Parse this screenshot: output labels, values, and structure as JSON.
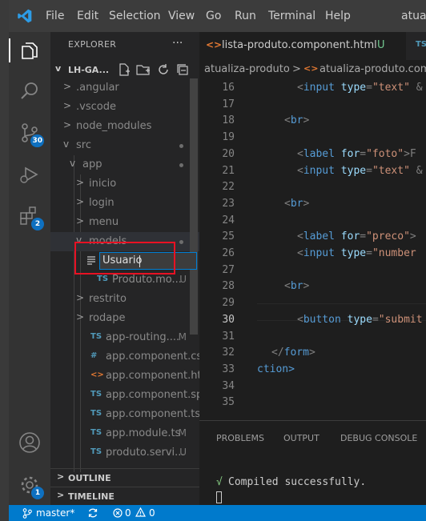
{
  "colors": {
    "accent": "#007acc",
    "badge": "#0e70c0",
    "annotation": "#e81123",
    "keyword": "#569cd6",
    "tag": "#569cd6",
    "attr": "#9cdcfe",
    "string": "#ce9178",
    "success": "#89d185"
  },
  "titlebar": {
    "menu": [
      "File",
      "Edit",
      "Selection",
      "View",
      "Go",
      "Run",
      "Terminal",
      "Help"
    ],
    "title": "atuali"
  },
  "activity": {
    "items": [
      {
        "name": "explorer-icon"
      },
      {
        "name": "search-icon"
      },
      {
        "name": "source-control-icon",
        "badge": "30"
      },
      {
        "name": "run-debug-icon"
      },
      {
        "name": "extensions-icon",
        "badge": "2"
      }
    ],
    "account_icon": "account-icon",
    "manage_icon": "gear-icon",
    "manage_badge": "1"
  },
  "explorer": {
    "header": "EXPLORER",
    "more": "···",
    "project": "LH-GA...",
    "toolbar_icons": [
      "new-file-icon",
      "new-folder-icon",
      "refresh-icon",
      "collapse-all-icon"
    ],
    "tree": [
      {
        "label": ".angular",
        "depth": 1,
        "chev": ">"
      },
      {
        "label": ".vscode",
        "depth": 1,
        "chev": ">"
      },
      {
        "label": "node_modules",
        "depth": 1,
        "chev": ">"
      },
      {
        "label": "src",
        "depth": 1,
        "chev": "v",
        "dot": true
      },
      {
        "label": "app",
        "depth": 2,
        "chev": "v",
        "dot": true
      },
      {
        "label": "inicio",
        "depth": 3,
        "chev": ">"
      },
      {
        "label": "login",
        "depth": 3,
        "chev": ">"
      },
      {
        "label": "menu",
        "depth": 3,
        "chev": ">"
      },
      {
        "label": "models",
        "depth": 3,
        "chev": "v",
        "dot": true
      },
      {
        "label": "",
        "depth": 4,
        "rename": true
      },
      {
        "label": "Produto.mo...",
        "depth": 4,
        "icon": "TS",
        "dec": "U"
      },
      {
        "label": "restrito",
        "depth": 3,
        "chev": ">"
      },
      {
        "label": "rodape",
        "depth": 3,
        "chev": ">"
      },
      {
        "label": "app-routing....",
        "depth": 3,
        "icon": "TS",
        "dec": "M"
      },
      {
        "label": "app.component.css",
        "depth": 3,
        "icon": "#"
      },
      {
        "label": "app.component.html",
        "depth": 3,
        "icon": "<>"
      },
      {
        "label": "app.component.sp...",
        "depth": 3,
        "icon": "TS"
      },
      {
        "label": "app.component.ts",
        "depth": 3,
        "icon": "TS"
      },
      {
        "label": "app.module.ts",
        "depth": 3,
        "icon": "TS",
        "dec": "M"
      },
      {
        "label": "produto.servi...",
        "depth": 3,
        "icon": "TS",
        "dec": "U"
      }
    ],
    "rename_value": "Usuario",
    "outline": "OUTLINE",
    "timeline": "TIMELINE"
  },
  "tabs": {
    "active": "lista-produto.component.html",
    "active_dec": "U",
    "next": "TS"
  },
  "breadcrumb": {
    "folder": "atualiza-produto",
    "sep": ">",
    "file": "atualiza-produto.com"
  },
  "editor": {
    "lines": [
      {
        "n": "16",
        "indent": 3,
        "tokens": [
          [
            "<",
            "p"
          ],
          [
            "input",
            "tag"
          ],
          [
            " ",
            "p"
          ],
          [
            "type",
            "attr"
          ],
          [
            "=",
            "p"
          ],
          [
            "\"text\"",
            "str"
          ],
          [
            " ",
            "p"
          ],
          [
            "&",
            "p"
          ]
        ]
      },
      {
        "n": "17",
        "indent": 0,
        "tokens": []
      },
      {
        "n": "18",
        "indent": 2,
        "tokens": [
          [
            "<",
            "p"
          ],
          [
            "br",
            "tag"
          ],
          [
            ">",
            "p"
          ]
        ]
      },
      {
        "n": "19",
        "indent": 0,
        "tokens": []
      },
      {
        "n": "20",
        "indent": 3,
        "tokens": [
          [
            "<",
            "p"
          ],
          [
            "label",
            "tag"
          ],
          [
            " ",
            "p"
          ],
          [
            "for",
            "attr"
          ],
          [
            "=",
            "p"
          ],
          [
            "\"foto\"",
            "str"
          ],
          [
            ">F",
            "p"
          ]
        ]
      },
      {
        "n": "21",
        "indent": 3,
        "tokens": [
          [
            "<",
            "p"
          ],
          [
            "input",
            "tag"
          ],
          [
            " ",
            "p"
          ],
          [
            "type",
            "attr"
          ],
          [
            "=",
            "p"
          ],
          [
            "\"text\"",
            "str"
          ],
          [
            " ",
            "p"
          ],
          [
            "&",
            "p"
          ]
        ]
      },
      {
        "n": "22",
        "indent": 0,
        "tokens": []
      },
      {
        "n": "23",
        "indent": 2,
        "tokens": [
          [
            "<",
            "p"
          ],
          [
            "br",
            "tag"
          ],
          [
            ">",
            "p"
          ]
        ]
      },
      {
        "n": "24",
        "indent": 0,
        "tokens": []
      },
      {
        "n": "25",
        "indent": 3,
        "tokens": [
          [
            "<",
            "p"
          ],
          [
            "label",
            "tag"
          ],
          [
            " ",
            "p"
          ],
          [
            "for",
            "attr"
          ],
          [
            "=",
            "p"
          ],
          [
            "\"preco\"",
            "str"
          ],
          [
            ">",
            "p"
          ]
        ]
      },
      {
        "n": "26",
        "indent": 3,
        "tokens": [
          [
            "<",
            "p"
          ],
          [
            "input",
            "tag"
          ],
          [
            " ",
            "p"
          ],
          [
            "type",
            "attr"
          ],
          [
            "=",
            "p"
          ],
          [
            "\"number",
            "str"
          ]
        ]
      },
      {
        "n": "27",
        "indent": 0,
        "tokens": []
      },
      {
        "n": "28",
        "indent": 2,
        "tokens": [
          [
            "<",
            "p"
          ],
          [
            "br",
            "tag"
          ],
          [
            ">",
            "p"
          ]
        ]
      },
      {
        "n": "29",
        "indent": 0,
        "tokens": []
      },
      {
        "n": "30",
        "indent": 3,
        "tokens": [
          [
            "<",
            "p"
          ],
          [
            "button",
            "tag"
          ],
          [
            " ",
            "p"
          ],
          [
            "type",
            "attr"
          ],
          [
            "=",
            "p"
          ],
          [
            "\"submit",
            "str"
          ]
        ],
        "current": true
      },
      {
        "n": "31",
        "indent": 0,
        "tokens": []
      },
      {
        "n": "32",
        "indent": 1,
        "tokens": [
          [
            "</",
            "p"
          ],
          [
            "form",
            "tag"
          ],
          [
            ">",
            "p"
          ]
        ]
      },
      {
        "n": "33",
        "indent": 0,
        "tokens": [
          [
            "ction>",
            "p"
          ]
        ]
      },
      {
        "n": "34",
        "indent": 0,
        "tokens": []
      },
      {
        "n": "35",
        "indent": 0,
        "tokens": []
      }
    ]
  },
  "panel": {
    "tabs": [
      "PROBLEMS",
      "OUTPUT",
      "DEBUG CONSOLE"
    ],
    "check": "√",
    "message": "Compiled successfully."
  },
  "status": {
    "branch": "master*",
    "errors": "0",
    "warnings": "0"
  }
}
